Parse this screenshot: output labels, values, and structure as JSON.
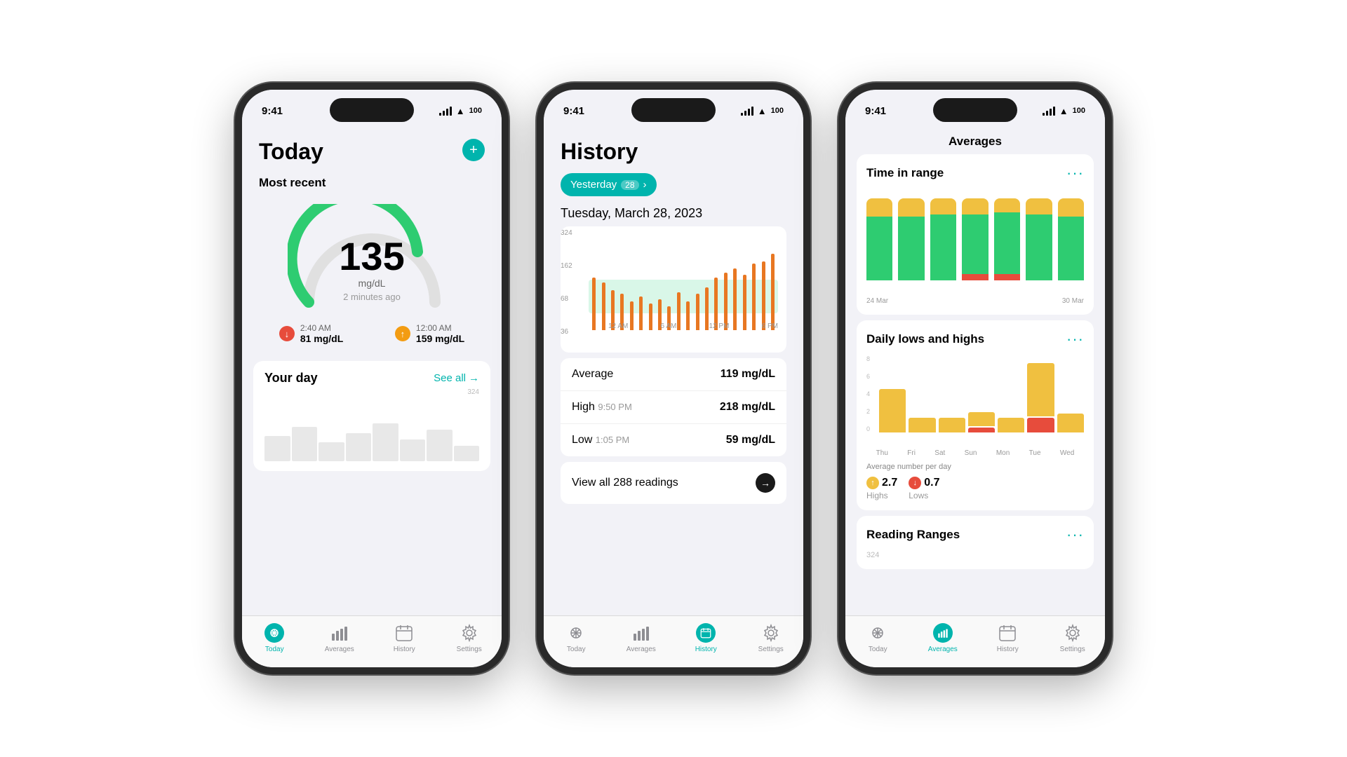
{
  "phone1": {
    "statusTime": "9:41",
    "battery": "100",
    "title": "Today",
    "mostRecent": "Most recent",
    "glucoseValue": "135",
    "glucoseUnit": "mg/dL",
    "glucoseTime": "2 minutes ago",
    "low": {
      "time": "2:40 AM",
      "value": "81 mg/dL",
      "direction": "down"
    },
    "high": {
      "time": "12:00 AM",
      "value": "159 mg/dL",
      "direction": "up"
    },
    "yourDay": "Your day",
    "seeAll": "See all",
    "chartMax": "324",
    "tabs": [
      {
        "label": "Today",
        "active": true
      },
      {
        "label": "Averages",
        "active": false
      },
      {
        "label": "History",
        "active": false
      },
      {
        "label": "Settings",
        "active": false
      }
    ]
  },
  "phone2": {
    "statusTime": "9:41",
    "battery": "100",
    "title": "History",
    "dateBadge": "Yesterday",
    "dateBadgeCount": "28",
    "date": "Tuesday, March 28, 2023",
    "chartLabels": {
      "yMax": "324",
      "y1": "162",
      "y2": "68",
      "y3": "36",
      "x": [
        "12 AM",
        "6 AM",
        "12 PM",
        "6 PM"
      ]
    },
    "stats": [
      {
        "label": "Average",
        "sub": "",
        "value": "119 mg/dL"
      },
      {
        "label": "High",
        "sub": "9:50 PM",
        "value": "218 mg/dL"
      },
      {
        "label": "Low",
        "sub": "1:05 PM",
        "value": "59 mg/dL"
      }
    ],
    "viewAll": "View all 288 readings",
    "tabs": [
      {
        "label": "Today",
        "active": false
      },
      {
        "label": "Averages",
        "active": false
      },
      {
        "label": "History",
        "active": true
      },
      {
        "label": "Settings",
        "active": false
      }
    ]
  },
  "phone3": {
    "statusTime": "9:41",
    "battery": "100",
    "title": "Averages",
    "sections": {
      "timeInRange": {
        "title": "Time in range",
        "dateStart": "24 Mar",
        "dateEnd": "30 Mar",
        "bars": [
          {
            "yellow": 20,
            "green": 80,
            "red": 0
          },
          {
            "yellow": 22,
            "green": 78,
            "red": 0
          },
          {
            "yellow": 18,
            "green": 82,
            "red": 0
          },
          {
            "yellow": 20,
            "green": 72,
            "red": 8
          },
          {
            "yellow": 15,
            "green": 77,
            "red": 8
          },
          {
            "yellow": 19,
            "green": 81,
            "red": 0
          },
          {
            "yellow": 21,
            "green": 75,
            "red": 4
          }
        ]
      },
      "dailyLows": {
        "title": "Daily lows and highs",
        "days": [
          "Thu",
          "Fri",
          "Sat",
          "Sun",
          "Mon",
          "Tue",
          "Wed"
        ],
        "bars": [
          {
            "yellow": 4.5,
            "red": 0
          },
          {
            "yellow": 1.5,
            "red": 0
          },
          {
            "yellow": 1.5,
            "red": 0
          },
          {
            "yellow": 1.5,
            "red": 0.5
          },
          {
            "yellow": 1.5,
            "red": 0
          },
          {
            "yellow": 5.5,
            "red": 1.5
          },
          {
            "yellow": 2,
            "red": 0
          }
        ],
        "yLabels": [
          "8",
          "6",
          "4",
          "2",
          "0"
        ],
        "avgLabel": "Average number per day",
        "highs": {
          "value": "2.7",
          "label": "Highs"
        },
        "lows": {
          "value": "0.7",
          "label": "Lows"
        }
      },
      "readingRanges": {
        "title": "Reading Ranges",
        "yLabel": "324"
      }
    },
    "tabs": [
      {
        "label": "Today",
        "active": false
      },
      {
        "label": "Averages",
        "active": true
      },
      {
        "label": "History",
        "active": false
      },
      {
        "label": "Settings",
        "active": false
      }
    ]
  }
}
